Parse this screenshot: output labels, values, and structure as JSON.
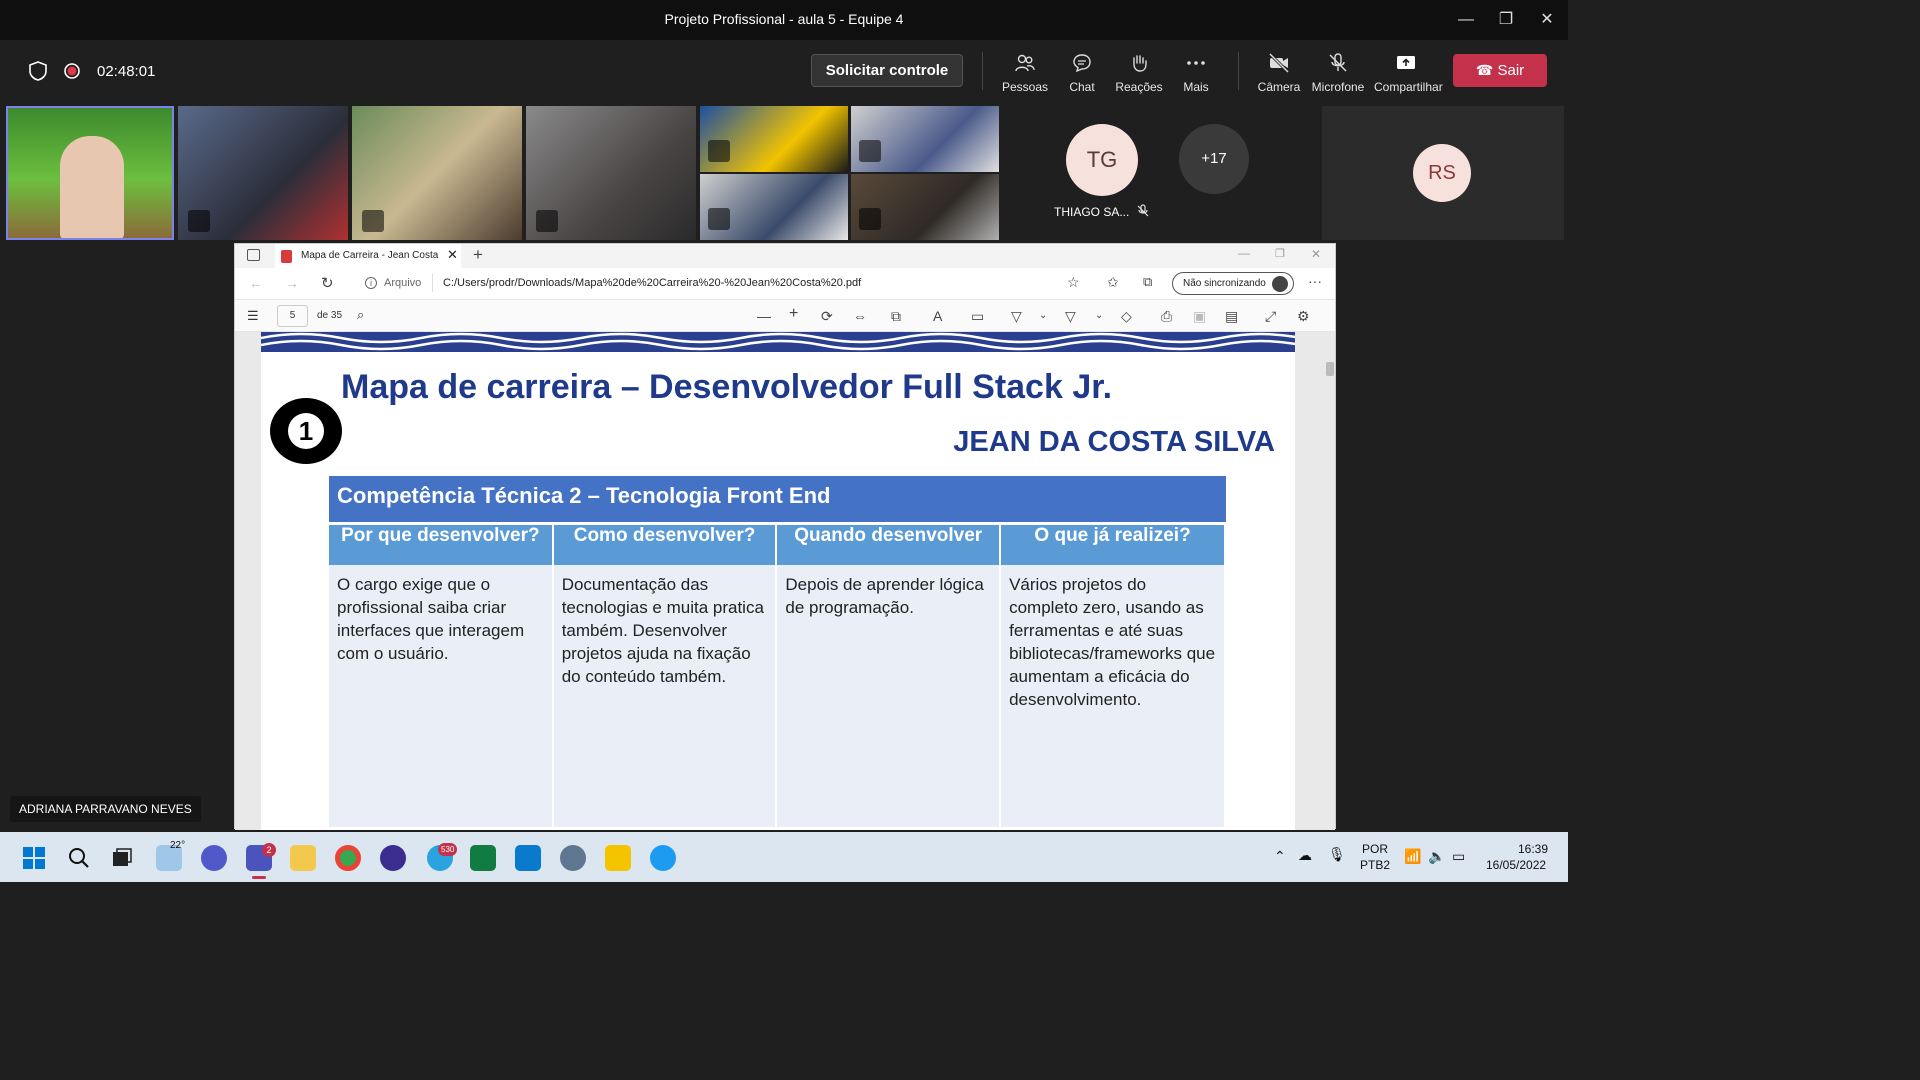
{
  "window": {
    "title": "Projeto Profissional - aula 5 - Equipe 4"
  },
  "toolbar": {
    "timer": "02:48:01",
    "request_control": "Solicitar controle",
    "people": "Pessoas",
    "chat": "Chat",
    "reactions": "Reações",
    "more": "Mais",
    "camera": "Câmera",
    "mic": "Microfone",
    "share": "Compartilhar",
    "leave": "Sair"
  },
  "participants": {
    "tg_initials": "TG",
    "tg_name": "THIAGO SA...",
    "overflow": "+17",
    "rs_initials": "RS",
    "presenter_name": "ADRIANA PARRAVANO NEVES"
  },
  "browser": {
    "tab_title": "Mapa de Carreira - Jean Costa .p",
    "arquivo": "Arquivo",
    "url": "C:/Users/prodr/Downloads/Mapa%20de%20Carreira%20-%20Jean%20Costa%20.pdf",
    "sync": "Não sincronizando",
    "page_num": "5",
    "page_total": "de 35"
  },
  "pdf": {
    "number": "1",
    "title": "Mapa de carreira – Desenvolvedor Full Stack Jr.",
    "author": "JEAN DA COSTA SILVA",
    "section": "Competência Técnica 2 – Tecnologia Front End",
    "headers": [
      "Por que desenvolver?",
      "Como desenvolver?",
      "Quando desenvolver",
      "O que já realizei?"
    ],
    "cells": [
      "O cargo exige que o profissional saiba criar interfaces que interagem com o usuário.",
      "Documentação das tecnologias e muita pratica também. Desenvolver projetos ajuda na fixação do conteúdo também.",
      "Depois de aprender lógica de programação.",
      "Vários projetos do completo zero, usando as ferramentas e até suas bibliotecas/frameworks que aumentam a eficácia do desenvolvimento."
    ]
  },
  "taskbar": {
    "weather": "22°",
    "teams_badge": "2",
    "telegram_badge": "530",
    "lang": "POR",
    "layout": "PTB2",
    "time": "16:39",
    "date": "16/05/2022"
  },
  "colors": {
    "pdf_navy": "#1f3a8a",
    "header_blue": "#4472c4",
    "col_blue": "#5b9bd5",
    "leave_red": "#c4314b"
  }
}
